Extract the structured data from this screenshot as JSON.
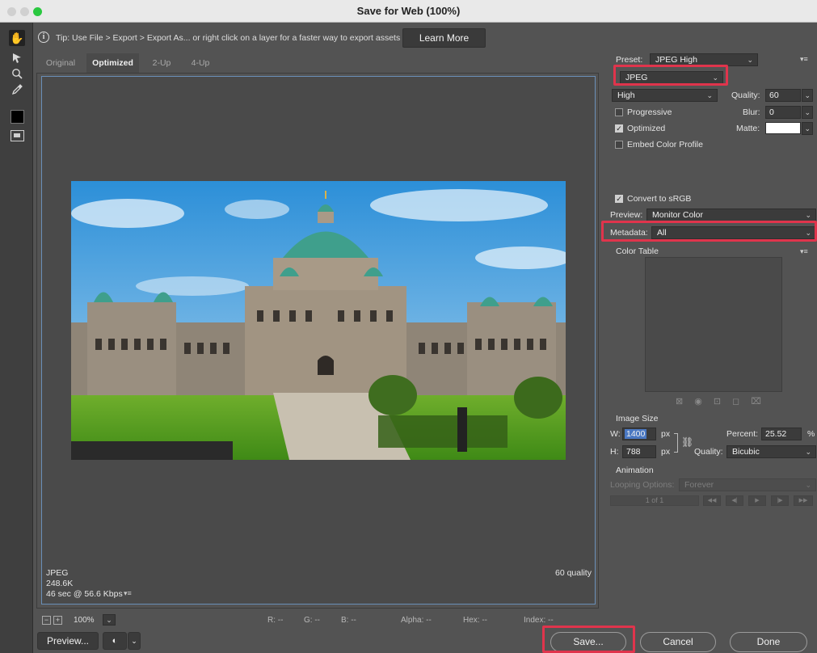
{
  "window": {
    "title": "Save for Web (100%)",
    "traffic_lights": [
      "#d0d0d0",
      "#d0d0d0",
      "#2ac840"
    ]
  },
  "tip": {
    "text": "Tip: Use File > Export > Export As... or right click on a layer for a faster way to export assets",
    "learn_more": "Learn More"
  },
  "tools": [
    "hand-icon",
    "slice-select-icon",
    "zoom-icon",
    "eyedropper-icon",
    "eyedropper-color-swatch",
    "toggle-slices-icon"
  ],
  "tabs": [
    "Original",
    "Optimized",
    "2-Up",
    "4-Up"
  ],
  "canvas": {
    "info_format": "JPEG",
    "info_size": "248.6K",
    "info_time": "46 sec @ 56.6 Kbps",
    "info_quality": "60 quality"
  },
  "settings": {
    "preset_label": "Preset:",
    "preset_value": "JPEG High",
    "format": "JPEG",
    "quality_level": "High",
    "quality_label": "Quality:",
    "quality_value": "60",
    "progressive": "Progressive",
    "blur_label": "Blur:",
    "blur_value": "0",
    "optimized": "Optimized",
    "matte_label": "Matte:",
    "embed_profile": "Embed Color Profile",
    "convert_srgb": "Convert to sRGB",
    "preview_label": "Preview:",
    "preview_value": "Monitor Color",
    "metadata_label": "Metadata:",
    "metadata_value": "All",
    "color_table": "Color Table"
  },
  "image_size": {
    "heading": "Image Size",
    "w_label": "W:",
    "w_value": "1400",
    "h_label": "H:",
    "h_value": "788",
    "unit": "px",
    "percent_label": "Percent:",
    "percent_value": "25.52",
    "percent_unit": "%",
    "quality_label": "Quality:",
    "quality_value": "Bicubic"
  },
  "animation": {
    "heading": "Animation",
    "looping_label": "Looping Options:",
    "looping_value": "Forever",
    "frame": "1 of 1"
  },
  "statusbar": {
    "zoom": "100%",
    "r": "R: --",
    "g": "G: --",
    "b": "B: --",
    "alpha": "Alpha: --",
    "hex": "Hex: --",
    "index": "Index: --"
  },
  "buttons": {
    "preview": "Preview...",
    "save": "Save...",
    "cancel": "Cancel",
    "done": "Done"
  },
  "colors": {
    "highlight": "#e0344c",
    "selection": "#4a78c2"
  }
}
